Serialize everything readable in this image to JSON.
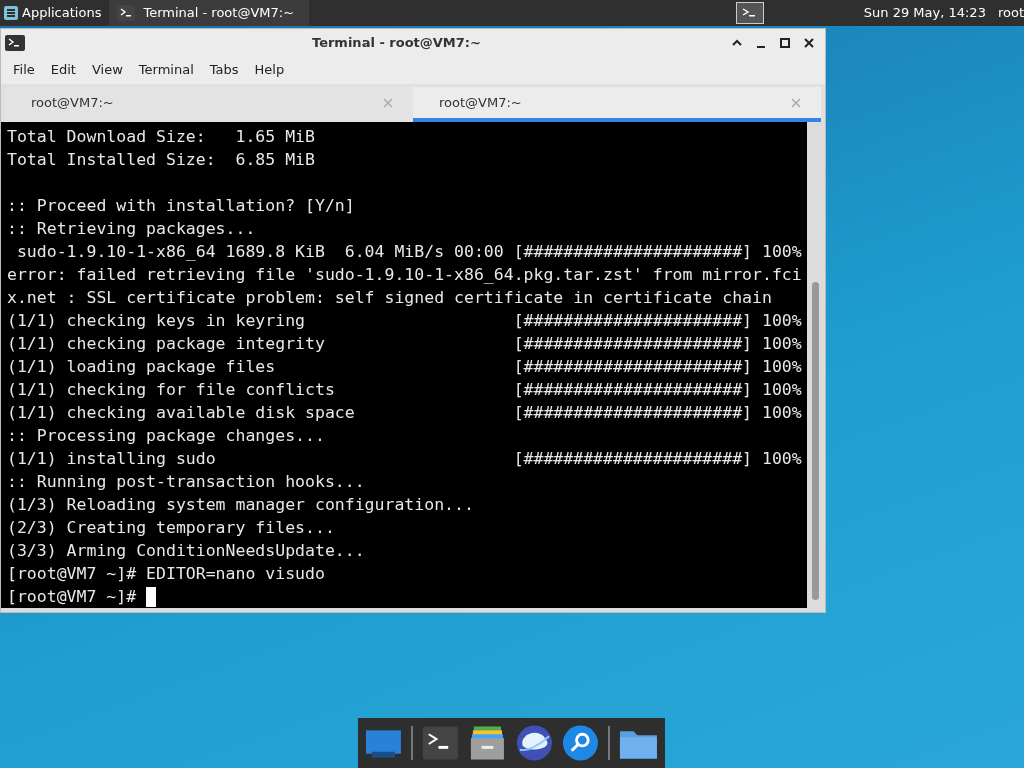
{
  "top_panel": {
    "applications": "Applications",
    "task": {
      "title": "Terminal - root@VM7:~",
      "selected": false
    },
    "clock": "Sun 29 May, 14:23",
    "user": "root"
  },
  "window": {
    "title": "Terminal - root@VM7:~",
    "menu": [
      "File",
      "Edit",
      "View",
      "Terminal",
      "Tabs",
      "Help"
    ],
    "tabs": [
      {
        "label": "root@VM7:~",
        "selected": false
      },
      {
        "label": "root@VM7:~",
        "selected": true
      }
    ],
    "terminal": {
      "blocks": [
        [
          "Total Download Size:   1.65 MiB",
          "Total Installed Size:  6.85 MiB"
        ],
        [
          ":: Proceed with installation? [Y/n]",
          ":: Retrieving packages...",
          " sudo-1.9.10-1-x86_64 1689.8 KiB  6.04 MiB/s 00:00 [######################] 100%",
          "error: failed retrieving file 'sudo-1.9.10-1-x86_64.pkg.tar.zst' from mirror.fci",
          "x.net : SSL certificate problem: self signed certificate in certificate chain",
          "(1/1) checking keys in keyring                     [######################] 100%",
          "(1/1) checking package integrity                   [######################] 100%",
          "(1/1) loading package files                        [######################] 100%",
          "(1/1) checking for file conflicts                  [######################] 100%",
          "(1/1) checking available disk space                [######################] 100%",
          ":: Processing package changes...",
          "(1/1) installing sudo                              [######################] 100%",
          ":: Running post-transaction hooks...",
          "(1/3) Reloading system manager configuration...",
          "(2/3) Creating temporary files...",
          "(3/3) Arming ConditionNeedsUpdate...",
          "[root@VM7 ~]# EDITOR=nano visudo",
          "[root@VM7 ~]# "
        ]
      ]
    }
  }
}
